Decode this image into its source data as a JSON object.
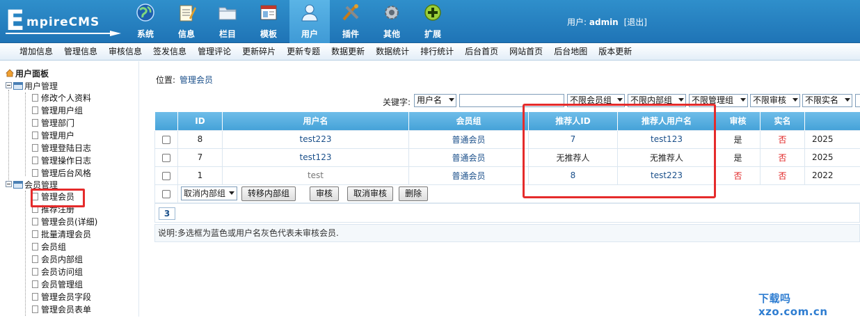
{
  "brand": {
    "logo_text": "EmpireCMS"
  },
  "topnav": [
    {
      "label": "系统",
      "icon": "globe-icon"
    },
    {
      "label": "信息",
      "icon": "notepad-icon"
    },
    {
      "label": "栏目",
      "icon": "folder-icon"
    },
    {
      "label": "模板",
      "icon": "window-icon"
    },
    {
      "label": "用户",
      "icon": "user-icon",
      "active": true
    },
    {
      "label": "插件",
      "icon": "tools-icon"
    },
    {
      "label": "其他",
      "icon": "gear-icon"
    },
    {
      "label": "扩展",
      "icon": "plus-icon"
    }
  ],
  "userinfo": {
    "prefix": "用户:",
    "username": "admin",
    "logout": "[退出]"
  },
  "submenu": [
    "增加信息",
    "管理信息",
    "审核信息",
    "签发信息",
    "管理评论",
    "更新碎片",
    "更新专题",
    "数据更新",
    "数据统计",
    "排行统计",
    "后台首页",
    "网站首页",
    "后台地图",
    "版本更新"
  ],
  "sidebar": {
    "title": "用户面板",
    "groups": [
      {
        "label": "用户管理",
        "items": [
          "修改个人资料",
          "管理用户组",
          "管理部门",
          "管理用户",
          "管理登陆日志",
          "管理操作日志",
          "管理后台风格"
        ]
      },
      {
        "label": "会员管理",
        "items": [
          "管理会员",
          "推荐注册",
          "管理会员(详细)",
          "批量清理会员",
          "会员组",
          "会员内部组",
          "会员访问组",
          "会员管理组",
          "管理会员字段",
          "管理会员表单"
        ]
      }
    ]
  },
  "breadcrumb": {
    "label": "位置:",
    "current": "管理会员"
  },
  "filters": {
    "keyword_label": "关键字:",
    "field_select": "用户名",
    "keyword_value": "",
    "selects": [
      "不限会员组",
      "不限内部组",
      "不限管理组",
      "不限审核",
      "不限实名"
    ]
  },
  "table": {
    "headers": [
      "",
      "ID",
      "用户名",
      "会员组",
      "推荐人ID",
      "推荐人用户名",
      "审核",
      "实名",
      ""
    ],
    "rows": [
      {
        "id": "8",
        "username": "test223",
        "group": "普通会员",
        "ref_id": "7",
        "ref_name": "test123",
        "checked": "是",
        "realname": "否",
        "date": "2025"
      },
      {
        "id": "7",
        "username": "test123",
        "group": "普通会员",
        "ref_id": "无推荐人",
        "ref_name": "无推荐人",
        "checked": "是",
        "realname": "否",
        "date": "2025"
      },
      {
        "id": "1",
        "username": "test",
        "group": "普通会员",
        "ref_id": "8",
        "ref_name": "test223",
        "checked": "否",
        "realname": "否",
        "date": "2022"
      }
    ],
    "actions": {
      "cancel_group_select": "取消内部组",
      "move_group": "转移内部组",
      "approve": "审核",
      "cancel_approve": "取消审核",
      "delete": "删除"
    }
  },
  "pager": {
    "current": "3"
  },
  "note": "说明:多选框为蓝色或用户名灰色代表未审核会员.",
  "watermark": "下载吗 xzo.com.cn",
  "colors": {
    "header": "#1f74b6",
    "table_head": "#45a2d8",
    "highlight": "#e52b2b",
    "link": "#1a4f8a"
  }
}
